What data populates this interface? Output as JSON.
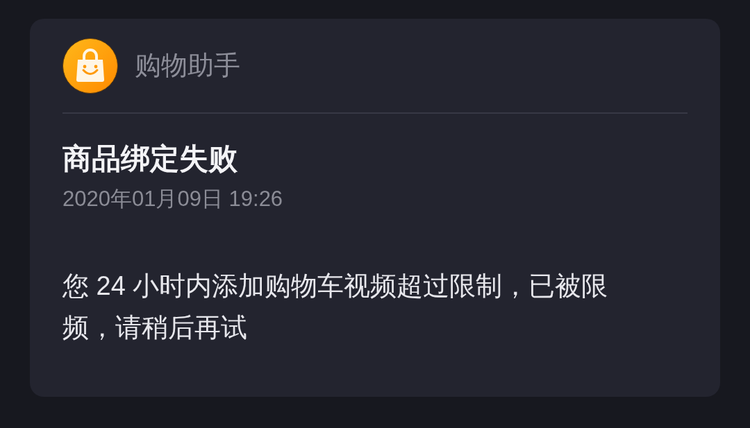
{
  "notification": {
    "app_name": "购物助手",
    "title": "商品绑定失败",
    "time": "2020年01月09日 19:26",
    "message": "您 24 小时内添加购物车视频超过限制，已被限频，请稍后再试"
  }
}
